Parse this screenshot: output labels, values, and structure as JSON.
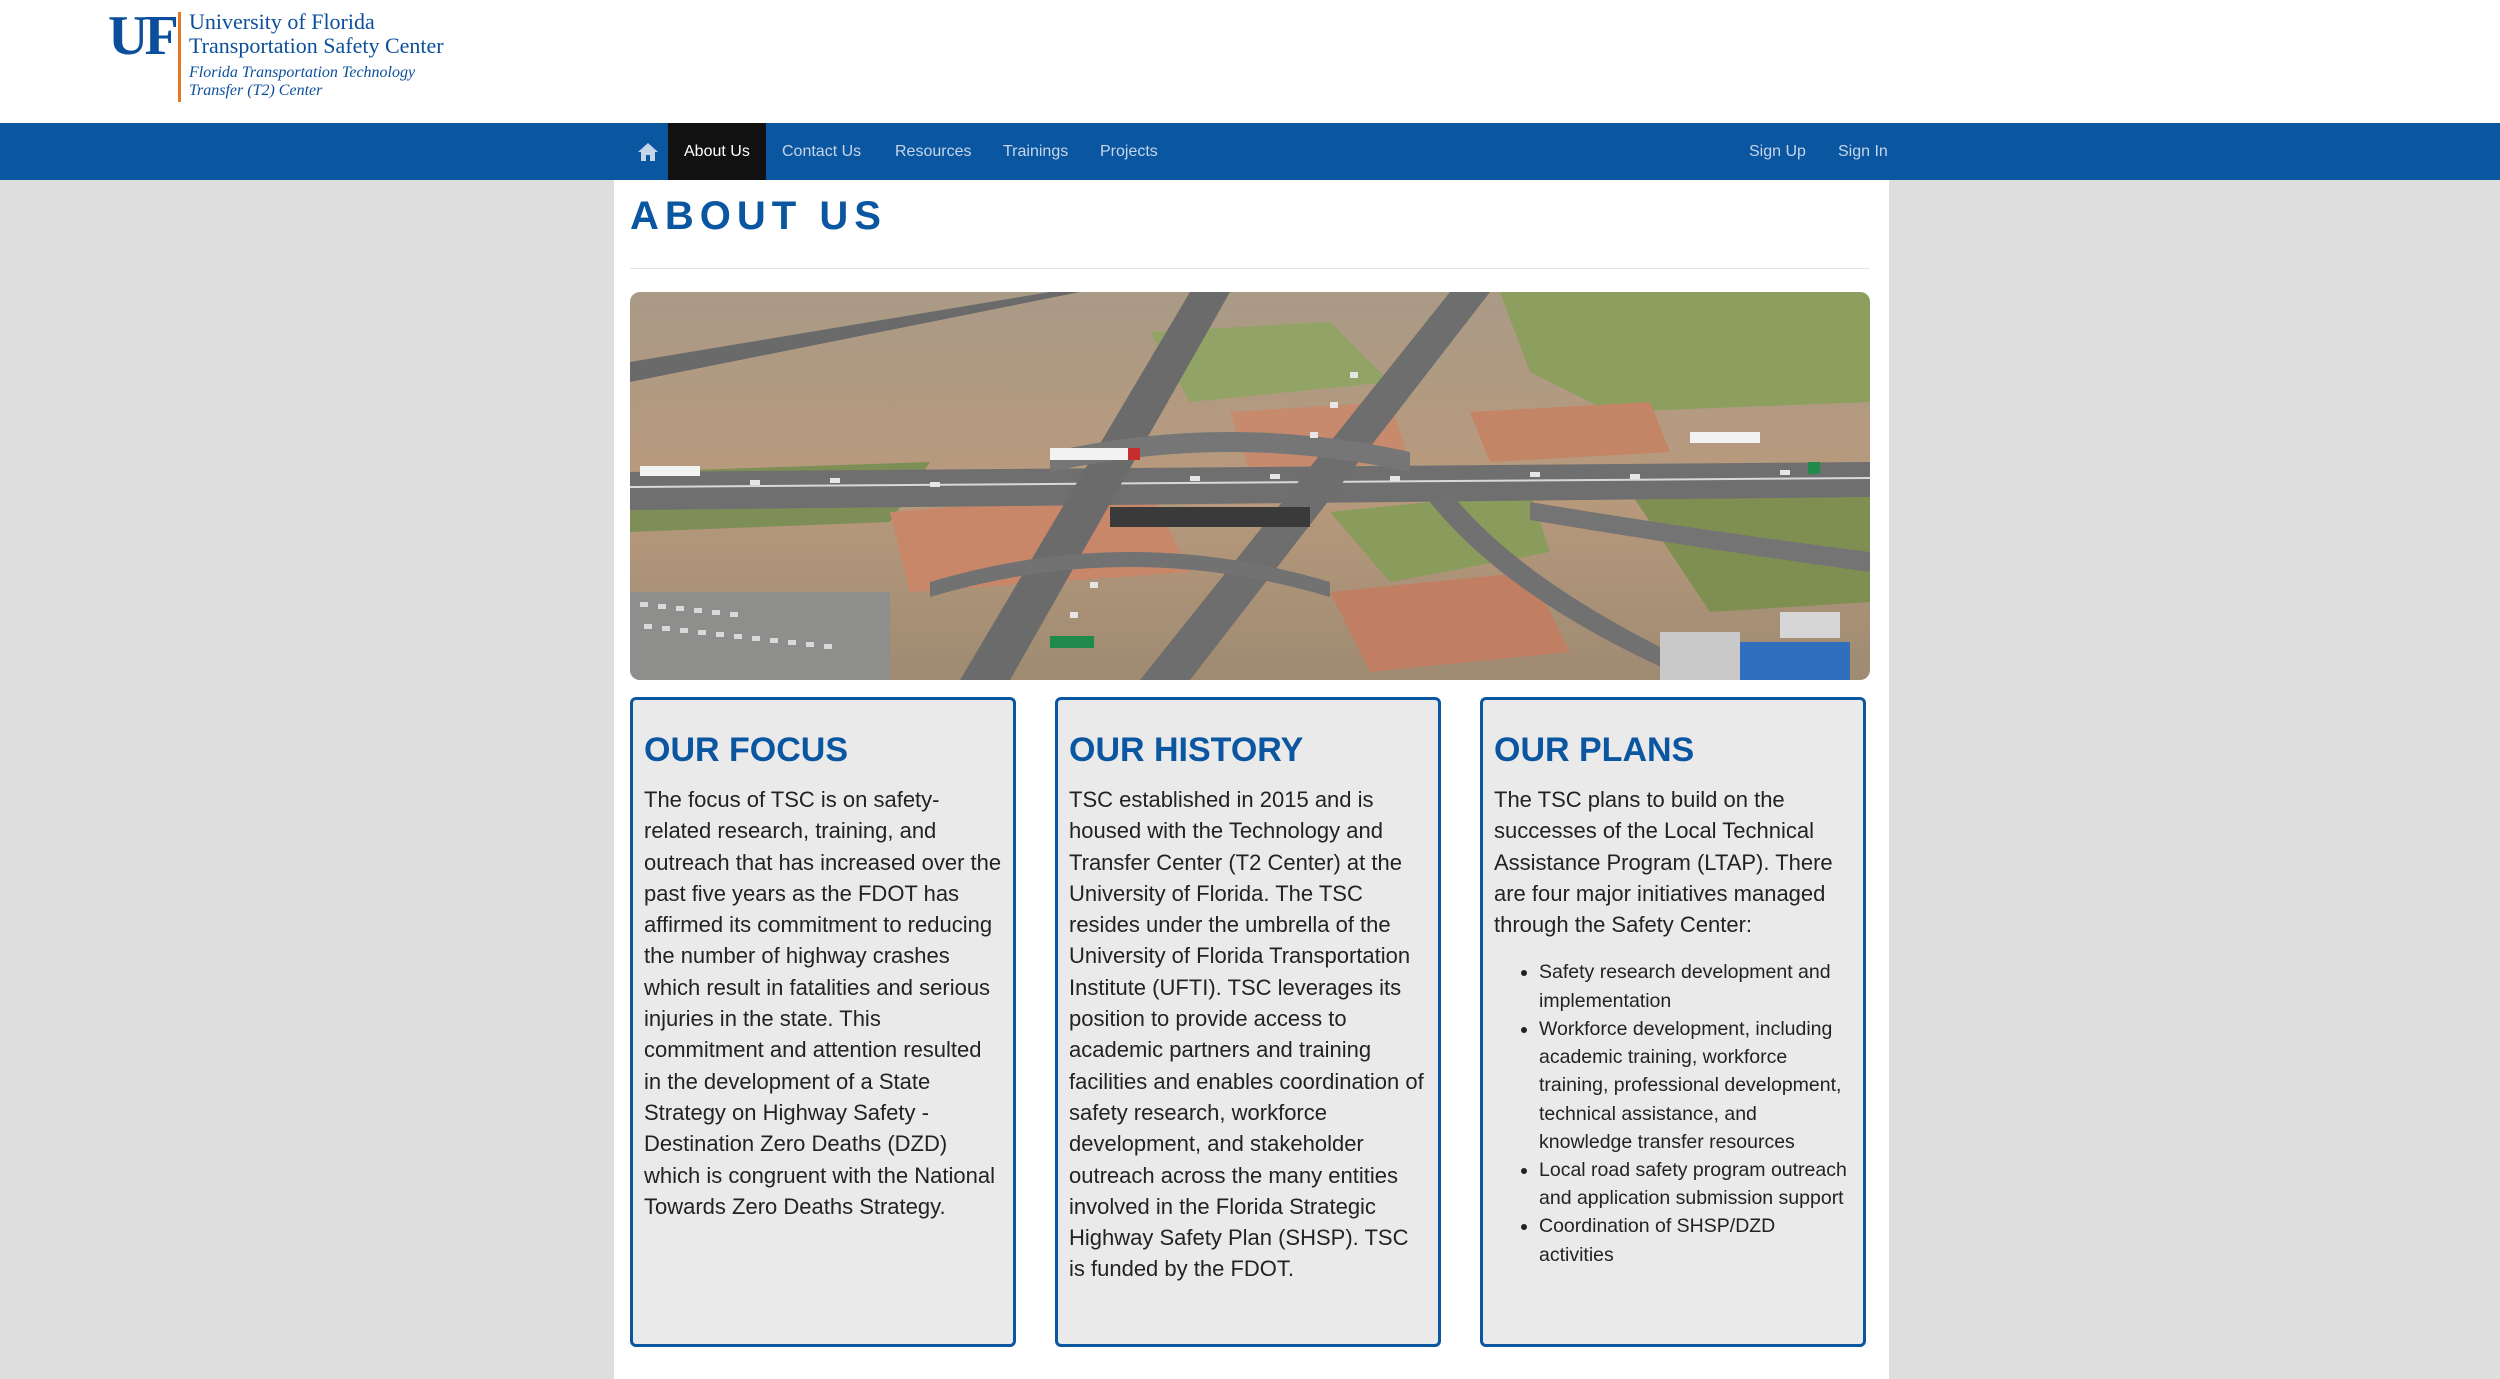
{
  "header": {
    "logo_mark": "UF",
    "logo_line1": "University of Florida",
    "logo_line2": "Transportation Safety Center",
    "logo_line3": "Florida Transportation Technology",
    "logo_line4": "Transfer (T2) Center"
  },
  "nav": {
    "home_icon": "home-icon",
    "items": [
      "About Us",
      "Contact Us",
      "Resources",
      "Trainings",
      "Projects"
    ],
    "active": "About Us",
    "sign_up": "Sign Up",
    "sign_in": "Sign In"
  },
  "page": {
    "title": "ABOUT US"
  },
  "cards": [
    {
      "title": "OUR FOCUS",
      "body": "The focus of TSC is on safety-related research, training, and outreach that has increased over the past five years as the FDOT has affirmed its commitment to reducing the number of highway crashes which result in fatalities and serious injuries in the state. This commitment and attention resulted in the development of a State Strategy on Highway Safety - Destination Zero Deaths (DZD) which is congruent with the National Towards Zero Deaths Strategy."
    },
    {
      "title": "OUR HISTORY",
      "body": "TSC established in 2015 and is housed with the Technology and Transfer Center (T2 Center) at the University of Florida. The TSC resides under the umbrella of the University of Florida Transportation Institute (UFTI). TSC leverages its position to provide access to academic partners and training facilities and enables coordination of safety research, workforce development, and stakeholder outreach across the many entities involved in the Florida Strategic Highway Safety Plan (SHSP). TSC is funded by the FDOT."
    },
    {
      "title": "OUR PLANS",
      "body": "The TSC plans to build on the successes of the Local Technical Assistance Program (LTAP). There are four major initiatives managed through the Safety Center:",
      "list": [
        "Safety research development and implementation",
        "Workforce development, including academic training, workforce training, professional development, technical assistance, and knowledge transfer resources",
        "Local road safety program outreach and application submission support",
        "Coordination of SHSP/DZD activities"
      ]
    }
  ],
  "colors": {
    "brand_blue": "#0b56a0",
    "brand_orange": "#e87722",
    "nav_active_bg": "#111111",
    "page_bg": "#dedede"
  }
}
